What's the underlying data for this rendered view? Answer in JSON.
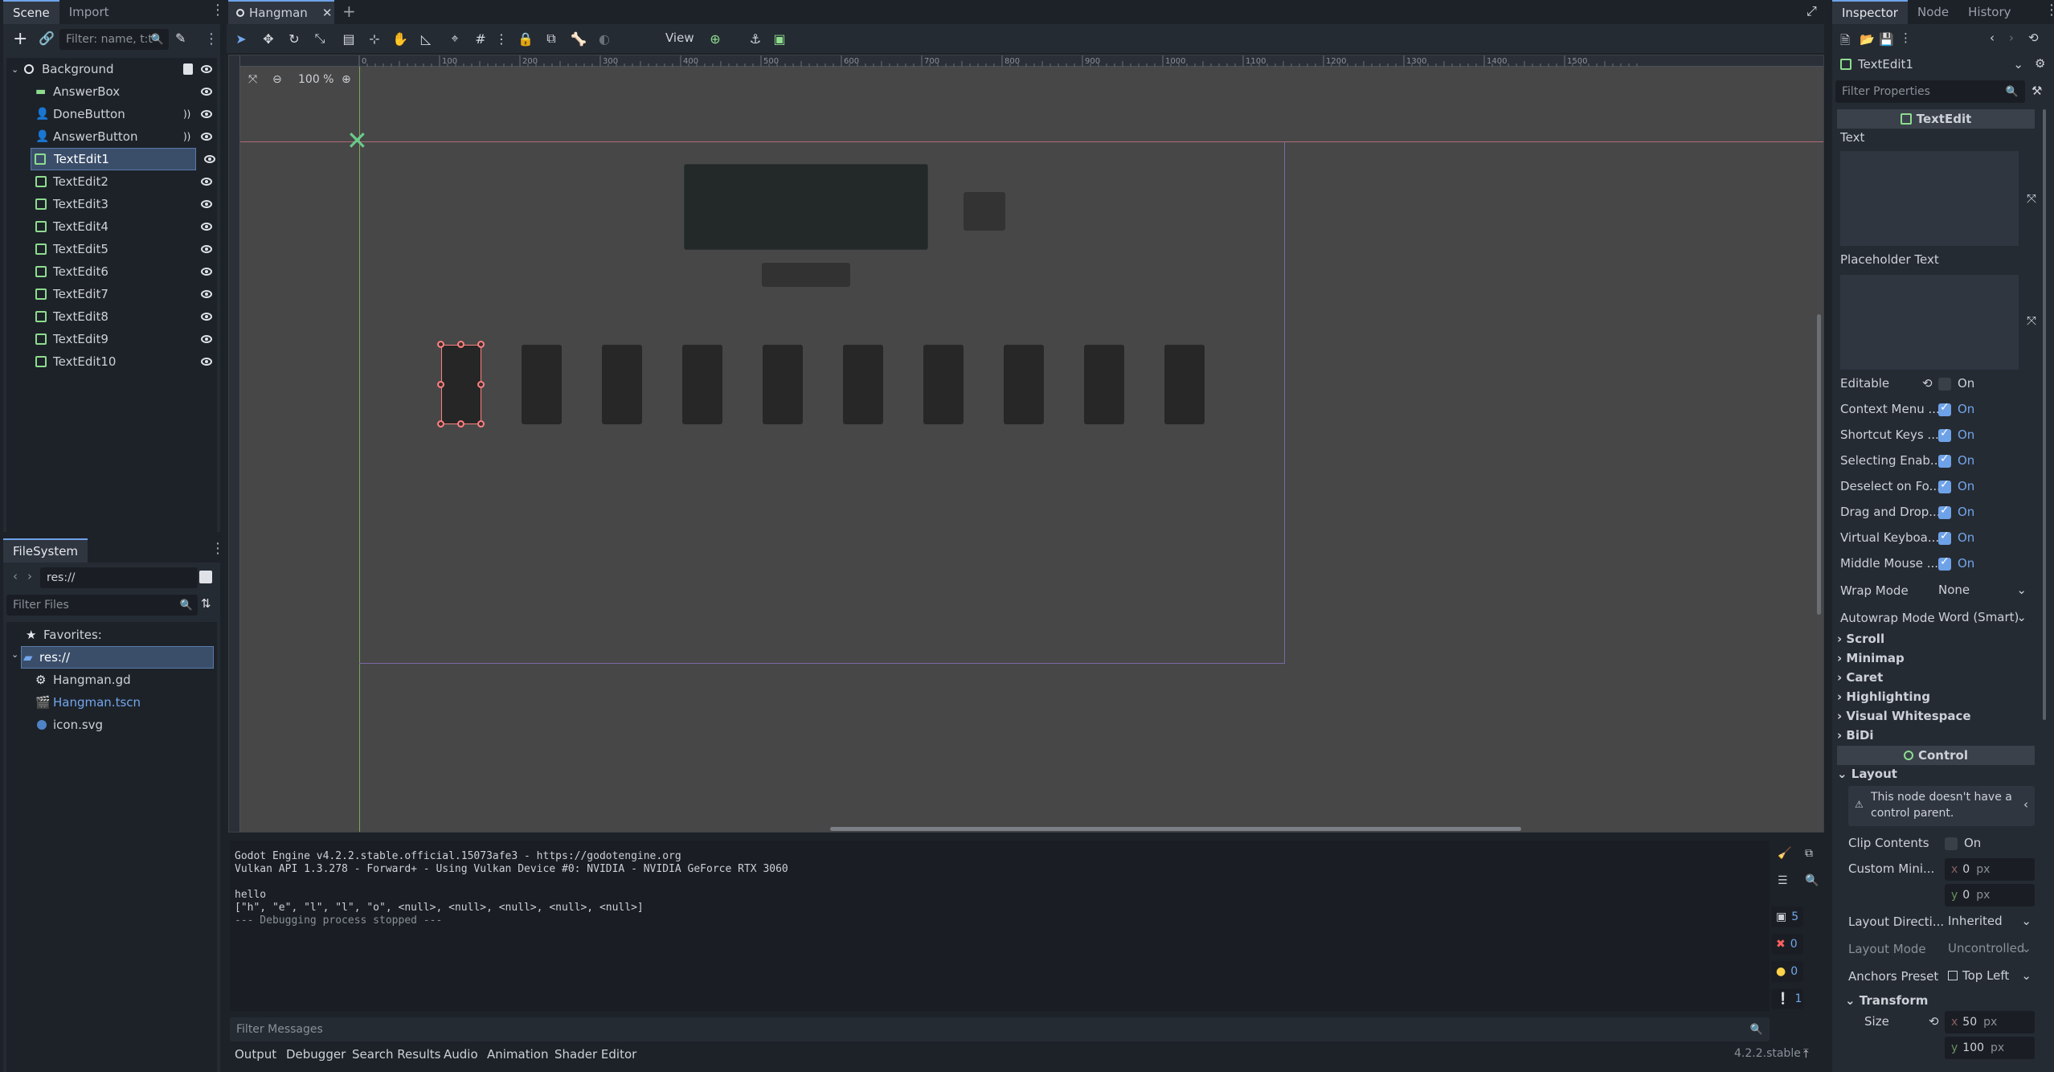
{
  "scene_dock": {
    "tabs": [
      "Scene",
      "Import"
    ],
    "filter_placeholder": "Filter: name, t:t",
    "tree": [
      {
        "label": "Background",
        "type": "root"
      },
      {
        "label": "AnswerBox",
        "type": "label"
      },
      {
        "label": "DoneButton",
        "type": "button"
      },
      {
        "label": "AnswerButton",
        "type": "button"
      },
      {
        "label": "TextEdit1",
        "type": "textedit",
        "selected": true
      },
      {
        "label": "TextEdit2",
        "type": "textedit"
      },
      {
        "label": "TextEdit3",
        "type": "textedit"
      },
      {
        "label": "TextEdit4",
        "type": "textedit"
      },
      {
        "label": "TextEdit5",
        "type": "textedit"
      },
      {
        "label": "TextEdit6",
        "type": "textedit"
      },
      {
        "label": "TextEdit7",
        "type": "textedit"
      },
      {
        "label": "TextEdit8",
        "type": "textedit"
      },
      {
        "label": "TextEdit9",
        "type": "textedit"
      },
      {
        "label": "TextEdit10",
        "type": "textedit"
      }
    ]
  },
  "filesystem": {
    "tab": "FileSystem",
    "path": "res://",
    "filter_placeholder": "Filter Files",
    "favorites": "Favorites:",
    "root": "res://",
    "files": [
      {
        "name": "Hangman.gd",
        "icon": "gear-icon"
      },
      {
        "name": "Hangman.tscn",
        "icon": "scene-icon",
        "highlight": true
      },
      {
        "name": "icon.svg",
        "icon": "image-icon"
      }
    ]
  },
  "editor": {
    "scene_tab": "Hangman",
    "view_menu": "View",
    "zoom": "100 %",
    "ruler_labels": [
      "0",
      "100",
      "200",
      "300",
      "400",
      "500",
      "600",
      "700",
      "800",
      "900",
      "1000",
      "1100",
      "1200",
      "1300",
      "1400",
      "1500"
    ]
  },
  "output": {
    "lines": [
      "Godot Engine v4.2.2.stable.official.15073afe3 - https://godotengine.org",
      "Vulkan API 1.3.278 - Forward+ - Using Vulkan Device #0: NVIDIA - NVIDIA GeForce RTX 3060",
      "",
      "hello",
      "[\"h\", \"e\", \"l\", \"l\", \"o\", <null>, <null>, <null>, <null>, <null>]",
      "--- Debugging process stopped ---"
    ],
    "filter_placeholder": "Filter Messages",
    "counters": [
      "5",
      "0",
      "0",
      "1"
    ],
    "tabs": [
      "Output",
      "Debugger",
      "Search Results",
      "Audio",
      "Animation",
      "Shader Editor"
    ],
    "version": "4.2.2.stable"
  },
  "inspector": {
    "tabs": [
      "Inspector",
      "Node",
      "History"
    ],
    "object": "TextEdit1",
    "filter_placeholder": "Filter Properties",
    "class_header": "TextEdit",
    "text_label": "Text",
    "placeholder_label": "Placeholder Text",
    "bool_props": [
      {
        "label": "Editable",
        "value": "On",
        "on": false
      },
      {
        "label": "Context Menu ...",
        "value": "On",
        "on": true
      },
      {
        "label": "Shortcut Keys ...",
        "value": "On",
        "on": true
      },
      {
        "label": "Selecting Enab...",
        "value": "On",
        "on": true
      },
      {
        "label": "Deselect on Fo...",
        "value": "On",
        "on": true
      },
      {
        "label": "Drag and Drop...",
        "value": "On",
        "on": true
      },
      {
        "label": "Virtual Keyboa...",
        "value": "On",
        "on": true
      },
      {
        "label": "Middle Mouse ...",
        "value": "On",
        "on": true
      }
    ],
    "wrap_mode_label": "Wrap Mode",
    "wrap_mode_value": "None",
    "autowrap_label": "Autowrap Mode",
    "autowrap_value": "Word (Smart)",
    "groups": [
      "Scroll",
      "Minimap",
      "Caret",
      "Highlighting",
      "Visual Whitespace",
      "BiDi"
    ],
    "control_header": "Control",
    "layout_label": "Layout",
    "layout_warning": "This node doesn't have a control parent.",
    "clip_label": "Clip Contents",
    "clip_value": "On",
    "custom_min_label": "Custom Mini...",
    "custom_min_x": "0",
    "custom_min_y": "0",
    "px": "px",
    "layout_dir_label": "Layout Directi...",
    "layout_dir_value": "Inherited",
    "layout_mode_label": "Layout Mode",
    "layout_mode_value": "Uncontrolled",
    "anchors_label": "Anchors Preset",
    "anchors_value": "Top Left",
    "transform_label": "Transform",
    "size_label": "Size",
    "size_x": "50",
    "size_y": "100"
  },
  "colors": {
    "accent": "#6ea2e8",
    "node_green": "#8edc8e",
    "selection_red": "#ff8080"
  }
}
